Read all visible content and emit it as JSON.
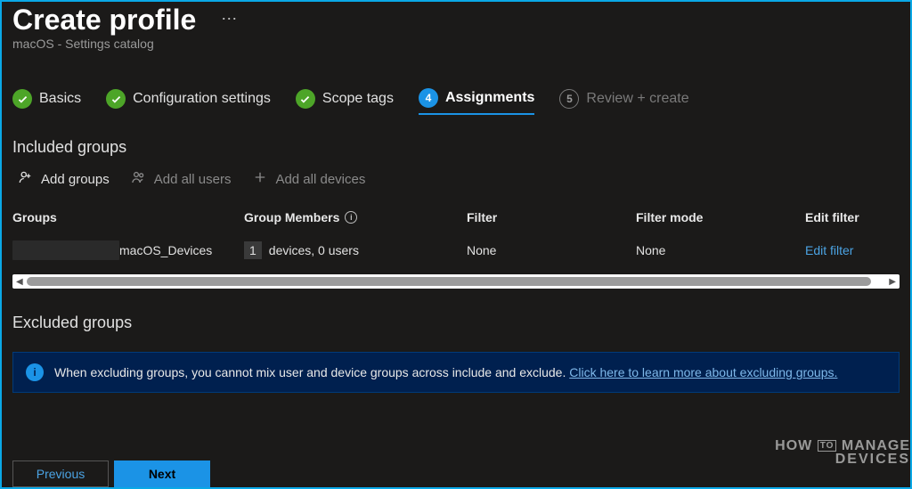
{
  "header": {
    "title": "Create profile",
    "subtitle": "macOS - Settings catalog"
  },
  "stepper": {
    "steps": [
      {
        "label": "Basics",
        "state": "done"
      },
      {
        "label": "Configuration settings",
        "state": "done"
      },
      {
        "label": "Scope tags",
        "state": "done"
      },
      {
        "label": "Assignments",
        "state": "active",
        "num": "4"
      },
      {
        "label": "Review + create",
        "state": "pending",
        "num": "5"
      }
    ]
  },
  "included": {
    "heading": "Included groups",
    "actions": {
      "add_groups": "Add groups",
      "add_all_users": "Add all users",
      "add_all_devices": "Add all devices"
    },
    "columns": {
      "groups": "Groups",
      "group_members": "Group Members",
      "filter": "Filter",
      "filter_mode": "Filter mode",
      "edit_filter": "Edit filter"
    },
    "rows": [
      {
        "group_suffix": "macOS_Devices",
        "members_num": "1",
        "members_rest": "devices, 0 users",
        "filter": "None",
        "filter_mode": "None",
        "edit_filter": "Edit filter"
      }
    ]
  },
  "excluded": {
    "heading": "Excluded groups",
    "banner_text": "When excluding groups, you cannot mix user and device groups across include and exclude. ",
    "banner_link": "Click here to learn more about excluding groups."
  },
  "footer": {
    "previous": "Previous",
    "next": "Next"
  },
  "watermark": {
    "l1a": "HOW",
    "l1b": "MANAGE",
    "l2": "DEVICES",
    "to": "TO"
  }
}
